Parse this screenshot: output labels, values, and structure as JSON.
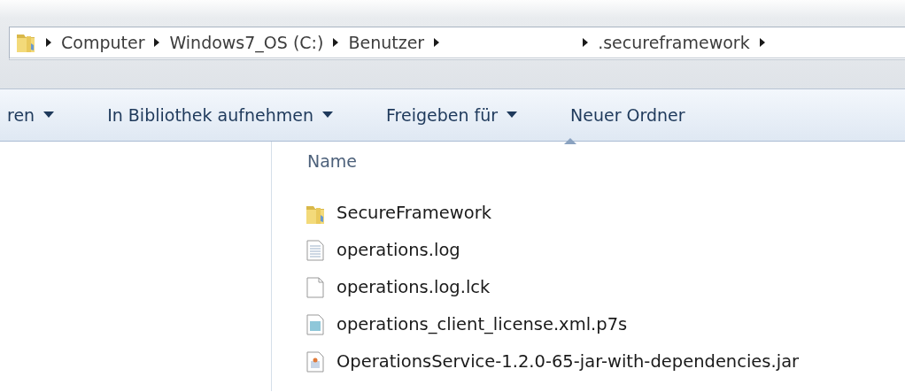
{
  "address_bar": {
    "segments": [
      {
        "label": "Computer"
      },
      {
        "label": "Windows7_OS (C:)"
      },
      {
        "label": "Benutzer"
      },
      {
        "kind": "redacted"
      },
      {
        "label": ".secureframework"
      }
    ]
  },
  "toolbar": [
    {
      "label": "ren",
      "dropdown": true
    },
    {
      "label": "In Bibliothek aufnehmen",
      "dropdown": true
    },
    {
      "label": "Freigeben für",
      "dropdown": true
    },
    {
      "label": "Neuer Ordner",
      "dropdown": false
    }
  ],
  "columns": [
    {
      "label": "Name",
      "sorted": true
    }
  ],
  "files": [
    {
      "name": "SecureFramework",
      "kind": "folder"
    },
    {
      "name": "operations.log",
      "kind": "text"
    },
    {
      "name": "operations.log.lck",
      "kind": "blank"
    },
    {
      "name": "operations_client_license.xml.p7s",
      "kind": "certificate"
    },
    {
      "name": "OperationsService-1.2.0-65-jar-with-dependencies.jar",
      "kind": "jar"
    }
  ]
}
